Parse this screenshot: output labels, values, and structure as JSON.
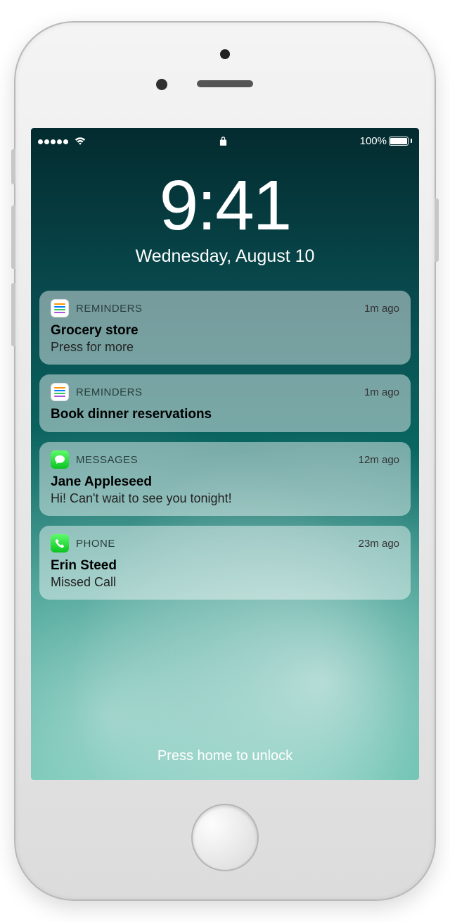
{
  "status": {
    "battery_text": "100%"
  },
  "clock": {
    "time": "9:41",
    "date": "Wednesday, August 10"
  },
  "notifications": [
    {
      "app": "REMINDERS",
      "icon": "reminders",
      "time": "1m ago",
      "title": "Grocery store",
      "body": "Press for more"
    },
    {
      "app": "REMINDERS",
      "icon": "reminders",
      "time": "1m ago",
      "title": "Book dinner reservations",
      "body": ""
    },
    {
      "app": "MESSAGES",
      "icon": "messages",
      "time": "12m ago",
      "title": "Jane Appleseed",
      "body": "Hi! Can't wait to see you tonight!"
    },
    {
      "app": "PHONE",
      "icon": "phone",
      "time": "23m ago",
      "title": "Erin Steed",
      "body": "Missed Call"
    }
  ],
  "unlock_hint": "Press home to unlock"
}
